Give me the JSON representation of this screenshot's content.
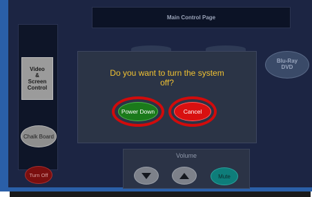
{
  "header": {
    "title": "Main Control Page"
  },
  "left_panel": {
    "video_button_lines": [
      "Video",
      "&",
      "Screen",
      "Control"
    ],
    "chalk_board_label": "Chalk Board",
    "turn_off_label": "Turn Off"
  },
  "right_panel": {
    "bluray_lines": [
      "Blu-Ray",
      "DVD"
    ]
  },
  "volume": {
    "label": "Volume",
    "mute_label": "Mute"
  },
  "dialog": {
    "question_line1": "Do you want to turn the system",
    "question_line2": "off?",
    "power_down_label": "Power Down",
    "cancel_label": "Cancel"
  },
  "colors": {
    "background": "#1c2543",
    "frame": "#2a5fa8",
    "question_text": "#f1c232",
    "highlight_ring": "#d10b0b",
    "power_down": "#1b7a1b",
    "cancel": "#d81010",
    "mute": "#0e7d7a"
  },
  "icons": {
    "volume_down": "triangle-down-icon",
    "volume_up": "triangle-up-icon"
  }
}
